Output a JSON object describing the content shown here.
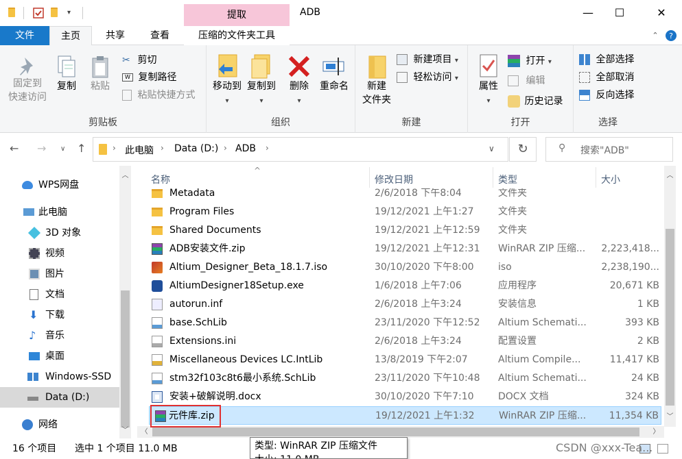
{
  "window": {
    "title": "ADB",
    "context_tab": "提取",
    "minimize": "—",
    "maximize": "☐",
    "close": "✕"
  },
  "tabs": {
    "file": "文件",
    "home": "主页",
    "share": "共享",
    "view": "查看",
    "tools": "压缩的文件夹工具"
  },
  "ribbon": {
    "clipboard": {
      "label": "剪贴板",
      "pin_line1": "固定到",
      "pin_line2": "快速访问",
      "copy": "复制",
      "paste": "粘贴",
      "cut": "剪切",
      "copy_path": "复制路径",
      "paste_shortcut": "粘贴快捷方式"
    },
    "organize": {
      "label": "组织",
      "move_to": "移动到",
      "copy_to": "复制到",
      "delete": "删除",
      "rename": "重命名"
    },
    "new": {
      "label": "新建",
      "new_folder_line1": "新建",
      "new_folder_line2": "文件夹",
      "new_item": "新建项目",
      "easy_access": "轻松访问"
    },
    "open": {
      "label": "打开",
      "properties": "属性",
      "open": "打开",
      "edit": "编辑",
      "history": "历史记录"
    },
    "select": {
      "label": "选择",
      "select_all": "全部选择",
      "select_none": "全部取消",
      "invert": "反向选择"
    }
  },
  "address": {
    "crumbs": [
      "此电脑",
      "Data (D:)",
      "ADB"
    ],
    "search_placeholder": "搜索\"ADB\""
  },
  "nav": [
    {
      "label": "WPS网盘",
      "icon": "cloud-icon"
    },
    {
      "label": "此电脑",
      "icon": "computer-icon"
    },
    {
      "label": "3D 对象",
      "icon": "3d-objects-icon"
    },
    {
      "label": "视频",
      "icon": "video-icon"
    },
    {
      "label": "图片",
      "icon": "pictures-icon"
    },
    {
      "label": "文档",
      "icon": "documents-icon"
    },
    {
      "label": "下载",
      "icon": "download-icon"
    },
    {
      "label": "音乐",
      "icon": "music-icon"
    },
    {
      "label": "桌面",
      "icon": "desktop-icon"
    },
    {
      "label": "Windows-SSD",
      "icon": "drive-icon"
    },
    {
      "label": "Data (D:)",
      "icon": "drive-icon"
    },
    {
      "label": "网络",
      "icon": "network-icon"
    }
  ],
  "columns": {
    "name": "名称",
    "modified": "修改日期",
    "type": "类型",
    "size": "大小"
  },
  "files": [
    {
      "name": "Metadata",
      "modified": "2/6/2018 下午8:04",
      "type": "文件夹",
      "size": "",
      "icon": "folder-icon"
    },
    {
      "name": "Program Files",
      "modified": "19/12/2021 上午1:27",
      "type": "文件夹",
      "size": "",
      "icon": "folder-icon"
    },
    {
      "name": "Shared Documents",
      "modified": "19/12/2021 上午12:59",
      "type": "文件夹",
      "size": "",
      "icon": "folder-icon"
    },
    {
      "name": "ADB安装文件.zip",
      "modified": "19/12/2021 上午12:31",
      "type": "WinRAR ZIP 压缩...",
      "size": "2,223,418...",
      "icon": "winrar-icon"
    },
    {
      "name": "Altium_Designer_Beta_18.1.7.iso",
      "modified": "30/10/2020 下午8:00",
      "type": "iso",
      "size": "2,238,190...",
      "icon": "iso-icon"
    },
    {
      "name": "AltiumDesigner18Setup.exe",
      "modified": "1/6/2018 上午7:06",
      "type": "应用程序",
      "size": "20,671 KB",
      "icon": "exe-icon"
    },
    {
      "name": "autorun.inf",
      "modified": "2/6/2018 上午3:24",
      "type": "安装信息",
      "size": "1 KB",
      "icon": "inf-icon"
    },
    {
      "name": "base.SchLib",
      "modified": "23/11/2020 下午12:52",
      "type": "Altium Schemati...",
      "size": "393 KB",
      "icon": "schlib-icon"
    },
    {
      "name": "Extensions.ini",
      "modified": "2/6/2018 上午3:24",
      "type": "配置设置",
      "size": "2 KB",
      "icon": "ini-icon"
    },
    {
      "name": "Miscellaneous Devices LC.IntLib",
      "modified": "13/8/2019 下午2:07",
      "type": "Altium Compile...",
      "size": "11,417 KB",
      "icon": "intlib-icon"
    },
    {
      "name": "stm32f103c8t6最小系统.SchLib",
      "modified": "23/11/2020 下午10:48",
      "type": "Altium Schemati...",
      "size": "24 KB",
      "icon": "schlib-icon"
    },
    {
      "name": "安装+破解说明.docx",
      "modified": "30/10/2020 下午7:10",
      "type": "DOCX 文档",
      "size": "324 KB",
      "icon": "docx-icon"
    },
    {
      "name": "元件库.zip",
      "modified": "19/12/2021 上午1:32",
      "type": "WinRAR ZIP 压缩...",
      "size": "11,354 KB",
      "icon": "winrar-icon"
    }
  ],
  "status": {
    "count": "16 个项目",
    "selected": "选中 1 个项目  11.0 MB"
  },
  "tooltip": {
    "line1": "类型: WinRAR ZIP 压缩文件",
    "line2": "大小: 11.0 MB"
  },
  "watermark": "CSDN @xxx-Tea..."
}
